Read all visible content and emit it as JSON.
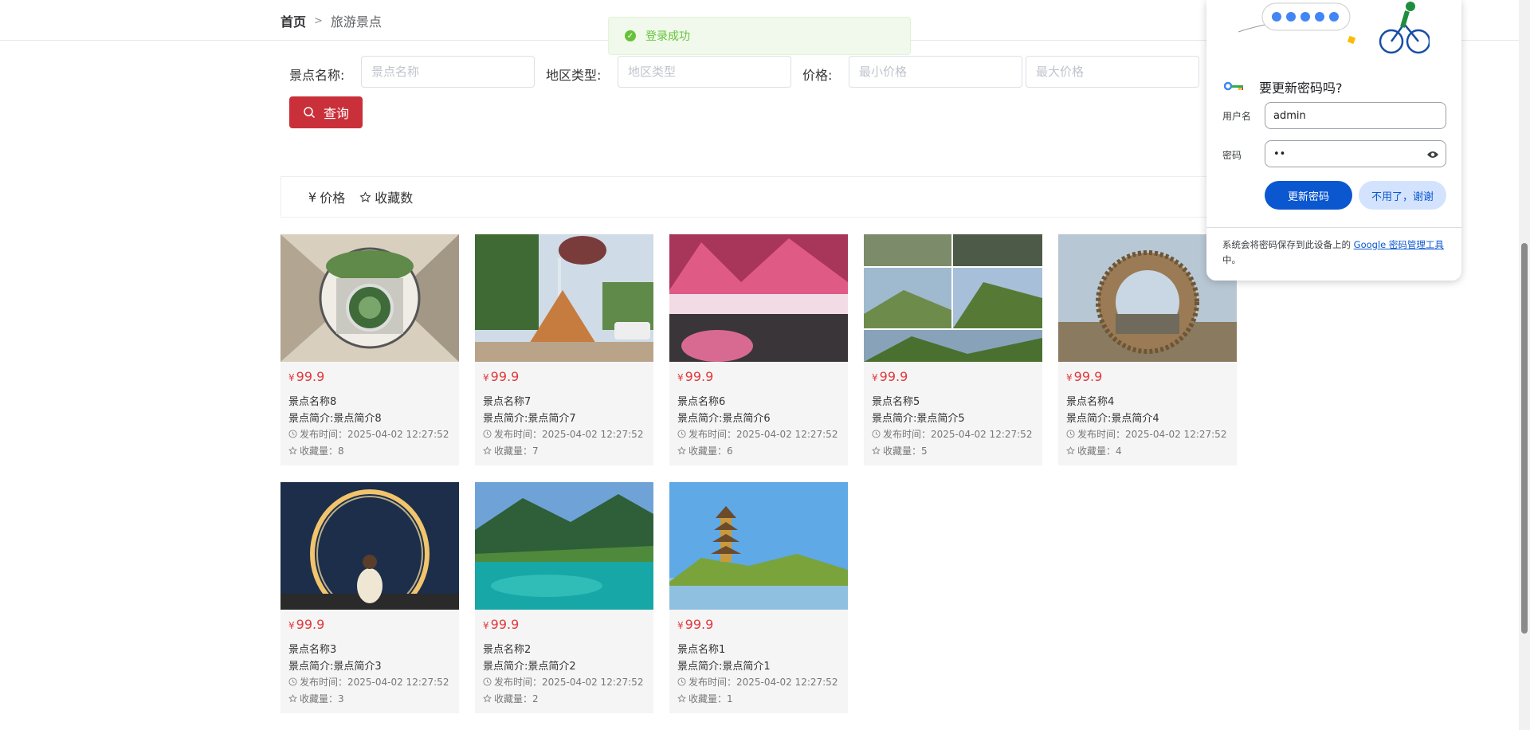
{
  "breadcrumb": {
    "home": "首页",
    "separator": ">",
    "current": "旅游景点"
  },
  "toast": {
    "text": "登录成功",
    "icon": "check-circle-icon",
    "color": "#67c23a"
  },
  "search": {
    "name_label": "景点名称:",
    "name_placeholder": "景点名称",
    "region_label": "地区类型:",
    "region_placeholder": "地区类型",
    "price_label": "价格:",
    "min_price_placeholder": "最小价格",
    "max_price_placeholder": "最大价格",
    "button_label": "查询",
    "button_color": "#c9303a"
  },
  "sort": {
    "price_label": "价格",
    "price_icon": "¥",
    "fav_label": "收藏数",
    "fav_icon": "star-icon"
  },
  "cards": [
    {
      "price": "99.9",
      "name": "景点名称8",
      "intro": "景点简介:景点简介8",
      "time": "发布时间：2025-04-02 12:27:52",
      "fav": "收藏量：8"
    },
    {
      "price": "99.9",
      "name": "景点名称7",
      "intro": "景点简介:景点简介7",
      "time": "发布时间：2025-04-02 12:27:52",
      "fav": "收藏量：7"
    },
    {
      "price": "99.9",
      "name": "景点名称6",
      "intro": "景点简介:景点简介6",
      "time": "发布时间：2025-04-02 12:27:52",
      "fav": "收藏量：6"
    },
    {
      "price": "99.9",
      "name": "景点名称5",
      "intro": "景点简介:景点简介5",
      "time": "发布时间：2025-04-02 12:27:52",
      "fav": "收藏量：5"
    },
    {
      "price": "99.9",
      "name": "景点名称4",
      "intro": "景点简介:景点简介4",
      "time": "发布时间：2025-04-02 12:27:52",
      "fav": "收藏量：4"
    },
    {
      "price": "99.9",
      "name": "景点名称3",
      "intro": "景点简介:景点简介3",
      "time": "发布时间：2025-04-02 12:27:52",
      "fav": "收藏量：3"
    },
    {
      "price": "99.9",
      "name": "景点名称2",
      "intro": "景点简介:景点简介2",
      "time": "发布时间：2025-04-02 12:27:52",
      "fav": "收藏量：2"
    },
    {
      "price": "99.9",
      "name": "景点名称1",
      "intro": "景点简介:景点简介1",
      "time": "发布时间：2025-04-02 12:27:52",
      "fav": "收藏量：1"
    }
  ],
  "currency_symbol": "¥",
  "password_popup": {
    "title": "要更新密码吗?",
    "username_label": "用户名",
    "username_value": "admin",
    "password_label": "密码",
    "password_value": "••",
    "update_button": "更新密码",
    "decline_button": "不用了，谢谢",
    "footer_text": "系统会将密码保存到此设备上的 ",
    "footer_link": "Google 密码管理工具",
    "footer_suffix": "中。",
    "primary_color": "#0b57d0"
  }
}
